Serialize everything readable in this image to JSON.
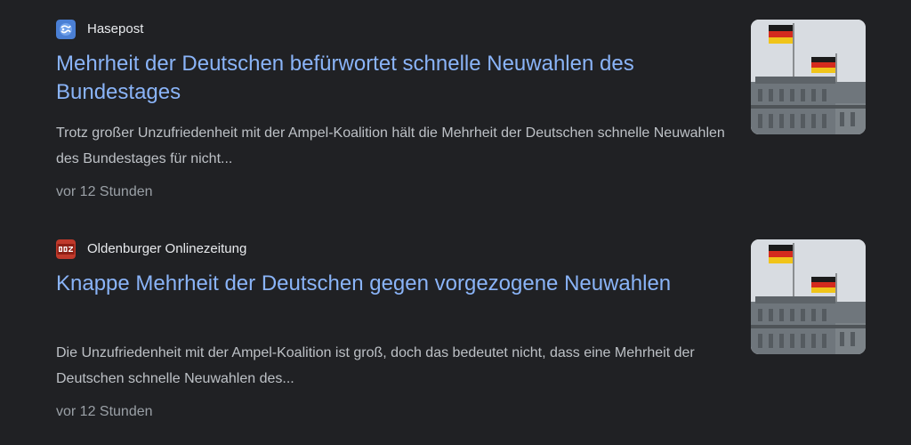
{
  "articles": [
    {
      "source": "Hasepost",
      "favicon": "hasepost-favicon-icon",
      "title": "Mehrheit der Deutschen befürwortet schnelle Neuwahlen des Bundestages",
      "snippet": "Trotz großer Unzufriedenheit mit der Ampel-Koalition hält die Mehrheit der Deutschen schnelle Neuwahlen des Bundestages für nicht...",
      "time": "vor 12 Stunden",
      "thumbnail": "reichstag-flags-image"
    },
    {
      "source": "Oldenburger Onlinezeitung",
      "favicon": "ooz-favicon-icon",
      "title": "Knappe Mehrheit der Deutschen gegen vorgezogene Neuwahlen",
      "snippet": "Die Unzufriedenheit mit der Ampel-Koalition ist groß, doch das bedeutet nicht, dass eine Mehrheit der Deutschen schnelle Neuwahlen des...",
      "time": "vor 12 Stunden",
      "thumbnail": "reichstag-flags-image"
    }
  ],
  "colors": {
    "background": "#202124",
    "title_link": "#8ab4f8",
    "source_text": "#e8eaed",
    "snippet_text": "#bdc1c6",
    "time_text": "#9aa0a6",
    "ooz_brand": "#c0392b",
    "hasepost_brand": "#4a7fd4"
  }
}
